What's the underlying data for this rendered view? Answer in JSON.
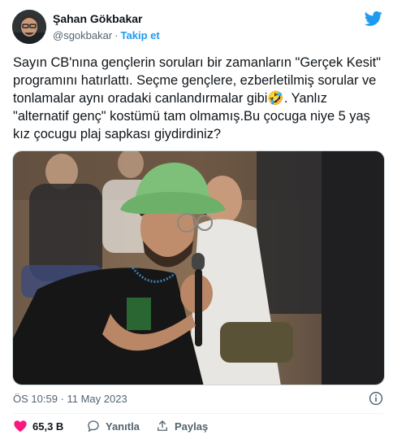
{
  "author": {
    "name": "Şahan Gökbakar",
    "handle": "@sgokbakar",
    "separator": "·",
    "follow_label": "Takip et"
  },
  "tweet": {
    "text": "Sayın CB'nına gençlerin soruları bir zamanların \"Gerçek Kesit\" programını hatırlattı. Seçme gençlere, ezberletilmiş sorular ve tonlamalar aynı oradaki canlandırmalar gibi🤣. Yanlız \"alternatif genç\" kostümü tam olmamış.Bu çocuga niye 5 yaş kız çocugu plaj sapkası giydirdiniz?",
    "timestamp": "ÖS 10:59 · 11 May 2023"
  },
  "actions": {
    "likes": "65,3 B",
    "reply_label": "Yanıtla",
    "copy_label": "Paylaş"
  },
  "colors": {
    "accent": "#1d9bf0",
    "like": "#f91880",
    "text": "#0f1419",
    "muted": "#536471"
  },
  "icons": {
    "brand": "twitter-bird-icon",
    "info": "info-icon",
    "like": "heart-icon",
    "reply": "reply-icon",
    "copy": "copy-link-icon"
  }
}
